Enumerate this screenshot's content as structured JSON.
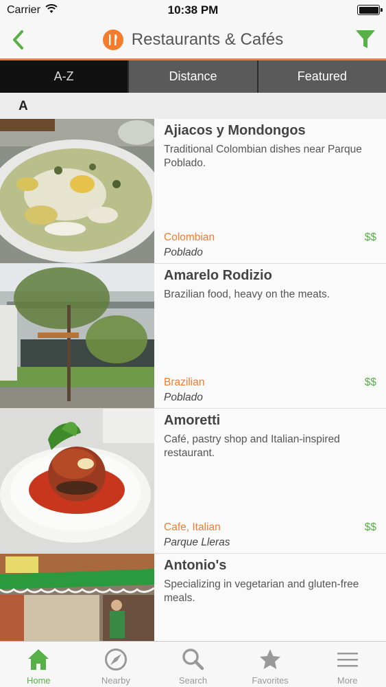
{
  "status_bar": {
    "carrier": "Carrier",
    "time": "10:38 PM"
  },
  "nav": {
    "title": "Restaurants & Cafés",
    "accent_color": "#f47c2c",
    "brand_green": "#58b048"
  },
  "segments": [
    {
      "label": "A-Z",
      "active": true
    },
    {
      "label": "Distance",
      "active": false
    },
    {
      "label": "Featured",
      "active": false
    }
  ],
  "section": {
    "letter": "A"
  },
  "restaurants": [
    {
      "name": "Ajiacos y Mondongos",
      "description": "Traditional Colombian dishes near Parque Poblado.",
      "cuisine": "Colombian",
      "price": "$$",
      "area": "Poblado",
      "image": "soup-photo"
    },
    {
      "name": "Amarelo Rodizio",
      "description": "Brazilian food, heavy on the meats.",
      "cuisine": "Brazilian",
      "price": "$$",
      "area": "Poblado",
      "image": "building-photo"
    },
    {
      "name": "Amoretti",
      "description": "Café, pastry shop and Italian-inspired restaurant.",
      "cuisine": "Cafe, Italian",
      "price": "$$",
      "area": "Parque Lleras",
      "image": "dish-photo"
    },
    {
      "name": "Antonio's",
      "description": "Specializing in vegetarian and gluten-free meals.",
      "cuisine": "",
      "price": "",
      "area": "",
      "image": "storefront-photo"
    }
  ],
  "tabs": [
    {
      "label": "Home",
      "icon": "home-icon",
      "active": true
    },
    {
      "label": "Nearby",
      "icon": "compass-icon",
      "active": false
    },
    {
      "label": "Search",
      "icon": "search-icon",
      "active": false
    },
    {
      "label": "Favorites",
      "icon": "star-icon",
      "active": false
    },
    {
      "label": "More",
      "icon": "menu-icon",
      "active": false
    }
  ]
}
